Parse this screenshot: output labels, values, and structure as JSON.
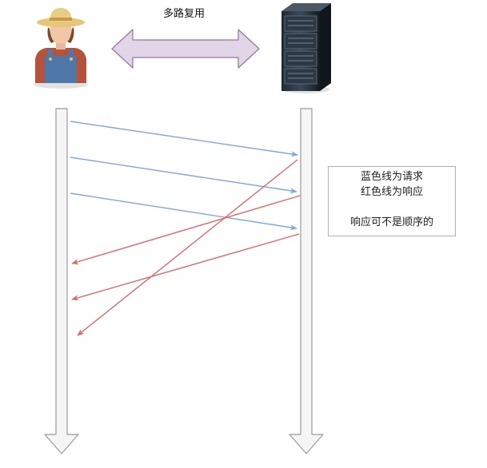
{
  "title": "多路复用",
  "note": {
    "line1": "蓝色线为请求",
    "line2": "红色线为响应",
    "line3": "响应可不是顺序的"
  },
  "colors": {
    "request": "#7ea6e0",
    "response": "#e06666",
    "lifeline_fill": "#f5f5f5",
    "lifeline_stroke": "#9a9a9a",
    "double_arrow_fill": "#e1d5e7",
    "double_arrow_stroke": "#9673a6"
  },
  "icons": {
    "client": "farmer-user-icon",
    "server": "server-rack-icon"
  }
}
